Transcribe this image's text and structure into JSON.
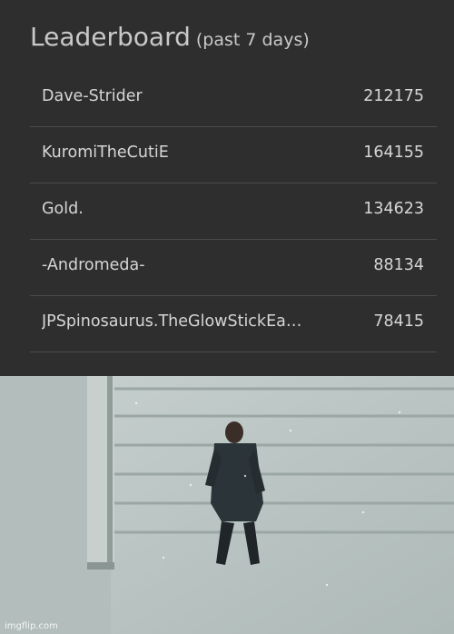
{
  "leaderboard": {
    "title": "Leaderboard",
    "subtitle": "(past 7 days)",
    "rows": [
      {
        "name": "Dave-Strider",
        "score": "212175"
      },
      {
        "name": "KuromiTheCutiE",
        "score": "164155"
      },
      {
        "name": "Gold.",
        "score": "134623"
      },
      {
        "name": "-Andromeda-",
        "score": "88134"
      },
      {
        "name": "JPSpinosaurus.TheGlowStickEa…",
        "score": "78415"
      }
    ]
  },
  "scene": {
    "description_icon": "person-lying-in-snow-photo"
  },
  "watermark": "imgflip.com",
  "colors": {
    "panel_bg": "#2e2e2e",
    "text": "#d6d6d6",
    "divider": "#4b4b4b",
    "snow": "#bcc6c4"
  }
}
